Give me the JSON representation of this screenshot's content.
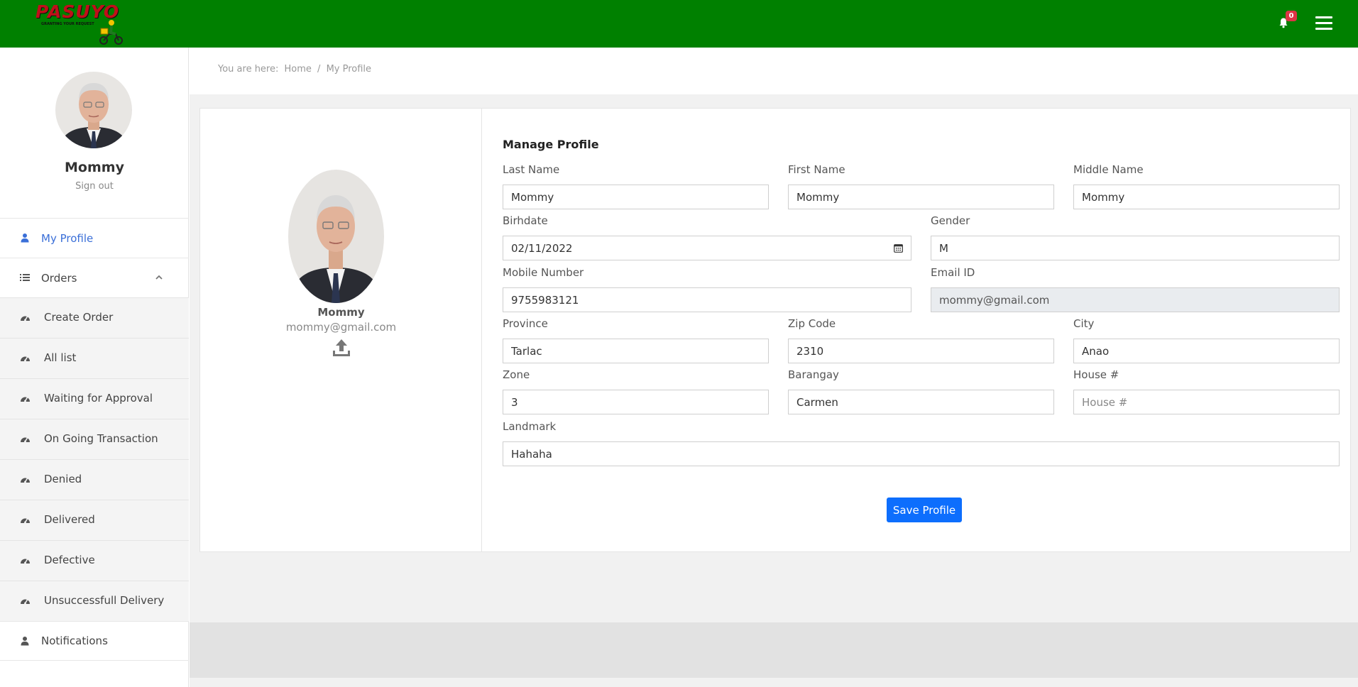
{
  "header": {
    "logo_text": "PASUYO",
    "logo_tagline": "GRANTING YOUR REQUEST",
    "notification_count": "0"
  },
  "sidebar": {
    "user_name": "Mommy",
    "sign_out": "Sign out",
    "items": [
      {
        "label": "My Profile",
        "icon": "user-icon",
        "active": true
      },
      {
        "label": "Orders",
        "icon": "list-icon",
        "expanded": true
      },
      {
        "label": "Notifications",
        "icon": "user-icon"
      }
    ],
    "order_subitems": [
      {
        "label": "Create Order",
        "icon": "dashboard-icon"
      },
      {
        "label": "All list",
        "icon": "dashboard-icon"
      },
      {
        "label": "Waiting for Approval",
        "icon": "dashboard-icon"
      },
      {
        "label": "On Going Transaction",
        "icon": "dashboard-icon"
      },
      {
        "label": "Denied",
        "icon": "dashboard-icon"
      },
      {
        "label": "Delivered",
        "icon": "dashboard-icon"
      },
      {
        "label": "Defective",
        "icon": "dashboard-icon"
      },
      {
        "label": "Unsuccessfull Delivery",
        "icon": "dashboard-icon"
      }
    ]
  },
  "breadcrumb": {
    "prefix": "You are here:",
    "home": "Home",
    "separator": "/",
    "current": "My Profile"
  },
  "profile_card": {
    "name": "Mommy",
    "email": "mommy@gmail.com"
  },
  "form": {
    "title": "Manage Profile",
    "last_name": {
      "label": "Last Name",
      "value": "Mommy"
    },
    "first_name": {
      "label": "First Name",
      "value": "Mommy"
    },
    "middle_name": {
      "label": "Middle Name",
      "value": "Mommy"
    },
    "birthdate": {
      "label": "Birhdate",
      "value": "02/11/2022"
    },
    "gender": {
      "label": "Gender",
      "value": "M"
    },
    "mobile": {
      "label": "Mobile Number",
      "value": "9755983121"
    },
    "email": {
      "label": "Email ID",
      "value": "mommy@gmail.com"
    },
    "province": {
      "label": "Province",
      "value": "Tarlac"
    },
    "zip": {
      "label": "Zip Code",
      "value": "2310"
    },
    "city": {
      "label": "City",
      "value": "Anao"
    },
    "zone": {
      "label": "Zone",
      "value": "3"
    },
    "barangay": {
      "label": "Barangay",
      "value": "Carmen"
    },
    "house": {
      "label": "House #",
      "value": "",
      "placeholder": "House #"
    },
    "landmark": {
      "label": "Landmark",
      "value": "Hahaha"
    },
    "save_label": "Save Profile"
  },
  "colors": {
    "topbar": "#008000",
    "active_link": "#3a6fd8",
    "primary_button": "#0d6efd",
    "badge": "#dc3545"
  }
}
